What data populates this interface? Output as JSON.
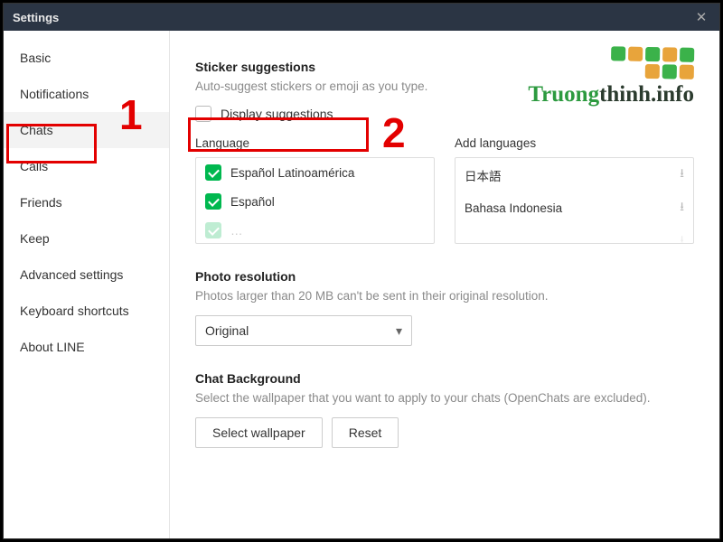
{
  "titlebar": {
    "title": "Settings"
  },
  "sidebar": {
    "items": [
      {
        "label": "Basic"
      },
      {
        "label": "Notifications"
      },
      {
        "label": "Chats"
      },
      {
        "label": "Calls"
      },
      {
        "label": "Friends"
      },
      {
        "label": "Keep"
      },
      {
        "label": "Advanced settings"
      },
      {
        "label": "Keyboard shortcuts"
      },
      {
        "label": "About LINE"
      }
    ],
    "active_index": 2
  },
  "main": {
    "sticker": {
      "title": "Sticker suggestions",
      "desc": "Auto-suggest stickers or emoji as you type.",
      "display_label": "Display suggestions",
      "lang_header": "Language",
      "addlang_header": "Add languages",
      "languages": [
        {
          "label": "Español Latinoamérica"
        },
        {
          "label": "Español"
        }
      ],
      "add_languages": [
        {
          "label": "日本語"
        },
        {
          "label": "Bahasa Indonesia"
        }
      ]
    },
    "photo": {
      "title": "Photo resolution",
      "desc": "Photos larger than 20 MB can't be sent in their original resolution.",
      "selected": "Original"
    },
    "bg": {
      "title": "Chat Background",
      "desc": "Select the wallpaper that you want to apply to your chats (OpenChats are excluded).",
      "select_label": "Select wallpaper",
      "reset_label": "Reset"
    }
  },
  "watermark": {
    "text_green": "Truong",
    "text_dark": "thinh.info"
  },
  "annotations": {
    "one": "1",
    "two": "2"
  }
}
